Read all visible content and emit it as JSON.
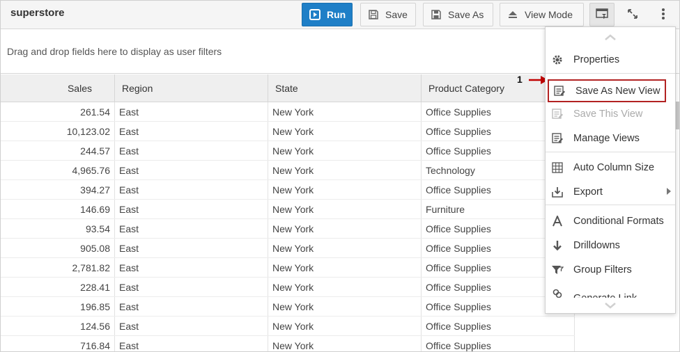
{
  "toolbar": {
    "title": "superstore",
    "run_label": "Run",
    "save_label": "Save",
    "save_as_label": "Save As",
    "view_mode_label": "View Mode"
  },
  "filter_area": {
    "placeholder": "Drag and drop fields here to display as user filters"
  },
  "grid": {
    "columns": [
      "Sales",
      "Region",
      "State",
      "Product Category"
    ],
    "rows": [
      [
        "261.54",
        "East",
        "New York",
        "Office Supplies"
      ],
      [
        "10,123.02",
        "East",
        "New York",
        "Office Supplies"
      ],
      [
        "244.57",
        "East",
        "New York",
        "Office Supplies"
      ],
      [
        "4,965.76",
        "East",
        "New York",
        "Technology"
      ],
      [
        "394.27",
        "East",
        "New York",
        "Office Supplies"
      ],
      [
        "146.69",
        "East",
        "New York",
        "Furniture"
      ],
      [
        "93.54",
        "East",
        "New York",
        "Office Supplies"
      ],
      [
        "905.08",
        "East",
        "New York",
        "Office Supplies"
      ],
      [
        "2,781.82",
        "East",
        "New York",
        "Office Supplies"
      ],
      [
        "228.41",
        "East",
        "New York",
        "Office Supplies"
      ],
      [
        "196.85",
        "East",
        "New York",
        "Office Supplies"
      ],
      [
        "124.56",
        "East",
        "New York",
        "Office Supplies"
      ],
      [
        "716.84",
        "East",
        "New York",
        "Office Supplies"
      ]
    ]
  },
  "menu": {
    "items": [
      {
        "label": "Properties",
        "icon": "gear-icon"
      },
      {
        "label": "Save As New View",
        "icon": "save-view-icon"
      },
      {
        "label": "Save This View",
        "icon": "save-view-icon",
        "disabled": true
      },
      {
        "label": "Manage Views",
        "icon": "manage-views-icon"
      },
      {
        "label": "Auto Column Size",
        "icon": "grid-icon"
      },
      {
        "label": "Export",
        "icon": "export-icon"
      },
      {
        "label": "Conditional Formats",
        "icon": "format-icon"
      },
      {
        "label": "Drilldowns",
        "icon": "arrow-down-icon"
      },
      {
        "label": "Group Filters",
        "icon": "filter-icon"
      },
      {
        "label": "Generate Link",
        "icon": "link-icon"
      }
    ]
  },
  "annotation": {
    "number": "1"
  },
  "colors": {
    "run_button": "#1f7fc7",
    "highlight_border": "#b22222",
    "annotation_arrow": "#c00000"
  }
}
